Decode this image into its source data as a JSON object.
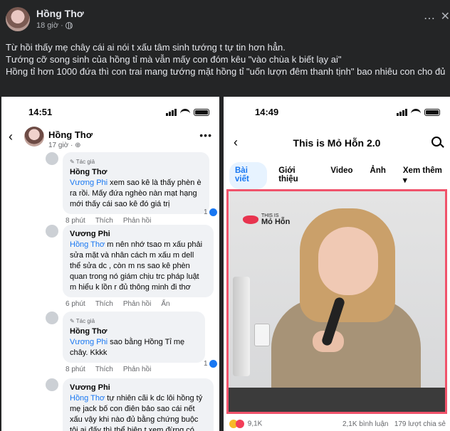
{
  "post": {
    "author": "Hồng Thơ",
    "time": "18 giờ ·",
    "more_icon": "⋯",
    "close_icon": "✕",
    "text_lines": [
      "Từ hồi thấy mẹ chây cái ai nói t xấu tâm sinh tướng t tự tin hơn hẳn.",
      "Tướng cỡ song sinh của hồng tỉ mà vẫn mấy con đóm kêu \"vào chùa k biết lạy ai\"",
      "Hồng tỉ hơn 1000 đứa thì con trai mang tướng mặt hồng tỉ \"uốn lượn đêm thanh tịnh\" bao nhiêu con cho đủ"
    ]
  },
  "left_phone": {
    "status_time": "14:51",
    "profile": {
      "name": "Hồng Thơ",
      "time": "17 giờ · ⊕"
    },
    "comments": [
      {
        "badge": "✎ Tác giả",
        "name": "Hồng Thơ",
        "mention": "Vương Phi",
        "text": " xem sao kê là thấy phèn è ra rồi. Mấy đứa nghèo nàn mạt hạng mới thấy cái sao kê đó giá trị",
        "time": "8 phút",
        "like": "Thích",
        "reply": "Phản hồi",
        "reactions": "1"
      },
      {
        "name": "Vương Phi",
        "mention": "Hồng Thơ",
        "text": " m nên nhớ tsao m xấu phải sửa mặt và nhân cách m xấu m dell thể sửa dc , còn m ns sao kê phèn quan trong nó giám chịu trc pháp luật m hiểu k lồn r đủ thông minh đi thơ",
        "time": "6 phút",
        "like": "Thích",
        "reply": "Phản hồi",
        "hide": "Ẩn"
      },
      {
        "badge": "✎ Tác giả",
        "name": "Hồng Thơ",
        "mention": "Vương Phi",
        "text": " sao bằng Hồng Tỉ mẹ chây. Kkkk",
        "time": "8 phút",
        "like": "Thích",
        "reply": "Phản hồi",
        "reactions": "1"
      },
      {
        "name": "Vương Phi",
        "mention": "Hồng Thơ",
        "text": " tự nhiên cãi k dc lôi hồng tỷ mẹ jack bố con điên bảo sao cái nết xấu vậy khi nào đủ bằng chứng buộc tội ai đấy thì thể hiện t xem đừng có nói"
      }
    ]
  },
  "right_phone": {
    "status_time": "14:49",
    "title": "This is Mỏ Hỗn 2.0",
    "tabs": [
      "Bài viết",
      "Giới thiệu",
      "Video",
      "Ảnh",
      "Xem thêm ▾"
    ],
    "logo_small": "THIS IS",
    "logo_big": "Mỏ Hỗn",
    "reactions": "9,1K",
    "comments": "2,1K bình luận",
    "shares": "179 lượt chia sẻ"
  },
  "colors": {
    "accent": "#1877f2",
    "frame": "#f0536b",
    "bg_dark": "#242526"
  }
}
